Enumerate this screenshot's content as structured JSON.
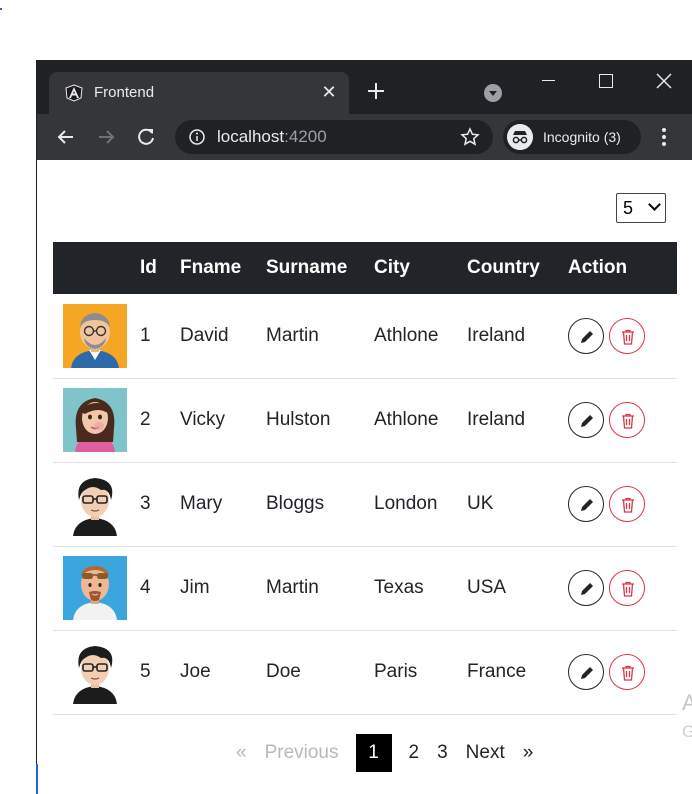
{
  "browser": {
    "tab_title": "Frontend",
    "url_host": "localhost",
    "url_port": ":4200",
    "incognito_label": "Incognito (3)"
  },
  "page_size": {
    "selected": "5"
  },
  "table": {
    "headers": [
      "",
      "Id",
      "Fname",
      "Surname",
      "City",
      "Country",
      "Action"
    ],
    "rows": [
      {
        "id": "1",
        "fname": "David",
        "surname": "Martin",
        "city": "Athlone",
        "country": "Ireland",
        "avatar": "man-glasses-avatar"
      },
      {
        "id": "2",
        "fname": "Vicky",
        "surname": "Hulston",
        "city": "Athlone",
        "country": "Ireland",
        "avatar": "woman-avatar"
      },
      {
        "id": "3",
        "fname": "Mary",
        "surname": "Bloggs",
        "city": "London",
        "country": "UK",
        "avatar": "man-dark-hair-glasses-avatar"
      },
      {
        "id": "4",
        "fname": "Jim",
        "surname": "Martin",
        "city": "Texas",
        "country": "USA",
        "avatar": "man-sunglasses-avatar"
      },
      {
        "id": "5",
        "fname": "Joe",
        "surname": "Doe",
        "city": "Paris",
        "country": "France",
        "avatar": "man-dark-hair-glasses-avatar"
      }
    ]
  },
  "pagination": {
    "first": "«",
    "previous": "Previous",
    "pages": [
      "1",
      "2",
      "3"
    ],
    "active": "1",
    "next": "Next",
    "last": "»"
  },
  "side_text": {
    "line1": "A",
    "line2": "G"
  },
  "colors": {
    "header_bg": "#212529",
    "delete": "#dc3545",
    "chrome_dark": "#202124",
    "chrome_toolbar": "#35363a"
  }
}
